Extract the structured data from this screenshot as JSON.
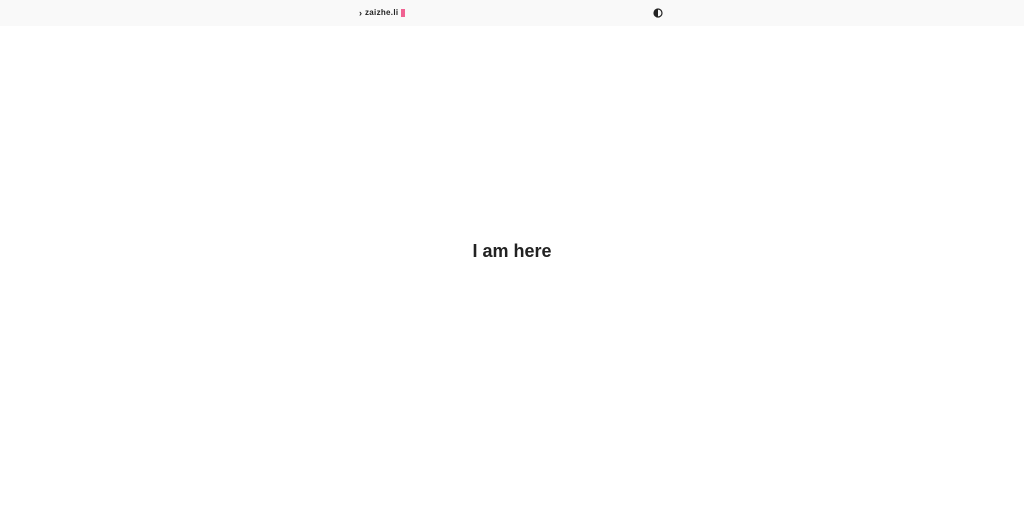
{
  "header": {
    "brand_prefix": "›",
    "brand": "zaizhe.li",
    "cursor_color": "#f06292",
    "theme_toggle_icon": "half-circle-contrast-icon"
  },
  "main": {
    "heading": "I am here"
  }
}
